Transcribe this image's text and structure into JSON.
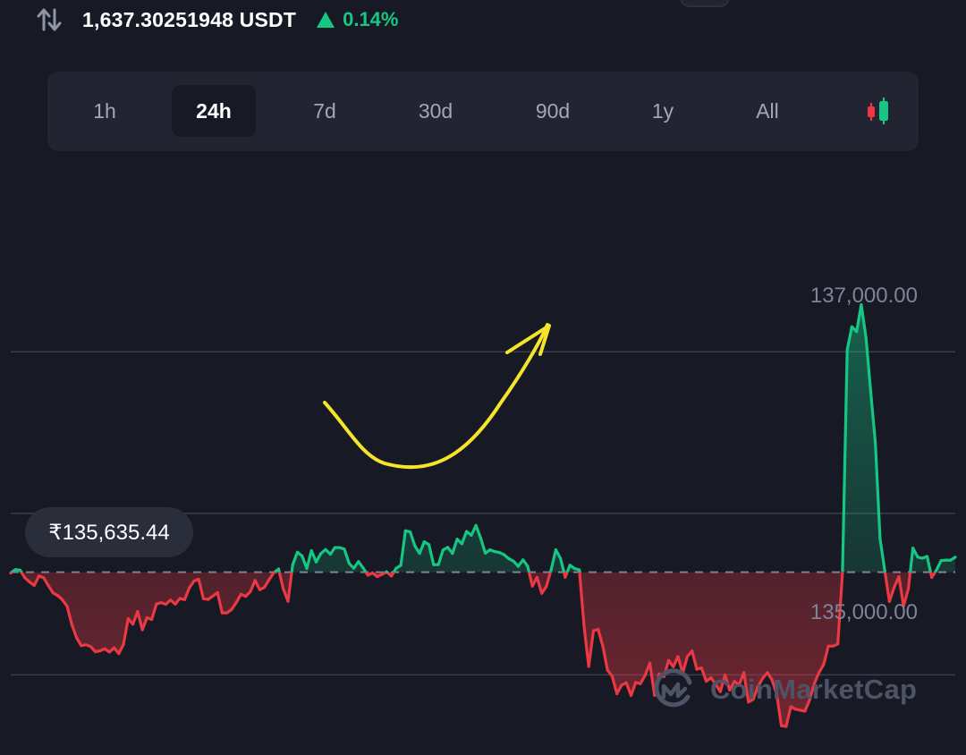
{
  "header": {
    "conversion_value": "1,637.30251948 USDT",
    "change_percent": "0.14%",
    "change_direction": "up",
    "swap_icon": "swap-vertical-arrows-icon"
  },
  "colors": {
    "background": "#171924",
    "panel": "#222531",
    "up": "#16c784",
    "down": "#ea3943",
    "grid": "#3a3e4f",
    "muted_text": "#7e8497",
    "annotation": "#f5e42a"
  },
  "tabs": [
    {
      "label": "1h",
      "active": false
    },
    {
      "label": "24h",
      "active": true
    },
    {
      "label": "7d",
      "active": false
    },
    {
      "label": "30d",
      "active": false
    },
    {
      "label": "90d",
      "active": false
    },
    {
      "label": "1y",
      "active": false
    },
    {
      "label": "All",
      "active": false
    }
  ],
  "chart_type_icon": "candlestick-icon",
  "price_badge": "₹135,635.44",
  "watermark": {
    "text": "CoinMarketCap",
    "icon": "coinmarketcap-logo-icon"
  },
  "chart_data": {
    "type": "line",
    "baseline": 135635.44,
    "ylim": [
      134620,
      137500
    ],
    "yticks": [
      135000,
      137000
    ],
    "ytick_labels": [
      "135,000.00",
      "137,000.00"
    ],
    "gridlines": [
      135000,
      136000,
      137000
    ],
    "grid": true,
    "points_count": 200,
    "values": [
      135630,
      135652,
      135648,
      135601,
      135575,
      135554,
      135612,
      135601,
      135553,
      135507,
      135491,
      135464,
      135425,
      135312,
      135230,
      135181,
      135186,
      135175,
      135143,
      135149,
      135161,
      135141,
      135167,
      135132,
      135190,
      135348,
      135314,
      135392,
      135279,
      135354,
      135343,
      135438,
      135447,
      135437,
      135463,
      135438,
      135473,
      135466,
      135538,
      135581,
      135592,
      135471,
      135467,
      135488,
      135509,
      135383,
      135384,
      135404,
      135448,
      135499,
      135486,
      135515,
      135584,
      135527,
      135542,
      135591,
      135633,
      135655,
      135533,
      135455,
      135681,
      135759,
      135736,
      135659,
      135769,
      135699,
      135751,
      135776,
      135747,
      135788,
      135788,
      135778,
      135690,
      135660,
      135701,
      135662,
      135617,
      135631,
      135608,
      135622,
      135638,
      135612,
      135659,
      135678,
      135892,
      135885,
      135799,
      135752,
      135824,
      135806,
      135682,
      135683,
      135773,
      135789,
      135752,
      135840,
      135812,
      135888,
      135864,
      135925,
      135847,
      135753,
      135774,
      135763,
      135757,
      135744,
      135719,
      135704,
      135672,
      135712,
      135673,
      135549,
      135603,
      135505,
      135548,
      135651,
      135774,
      135720,
      135604,
      135679,
      135658,
      135650,
      135302,
      135052,
      135273,
      135282,
      135177,
      135029,
      134990,
      134883,
      134937,
      134951,
      134872,
      134953,
      134945,
      134997,
      135073,
      134873,
      135005,
      134989,
      135089,
      135050,
      135113,
      135011,
      135114,
      135147,
      135035,
      135043,
      134960,
      134982,
      134941,
      134896,
      134999,
      134905,
      134959,
      134937,
      135014,
      134831,
      134849,
      134927,
      134978,
      135013,
      134969,
      134880,
      134685,
      134681,
      134802,
      134787,
      134781,
      134775,
      134844,
      134945,
      135013,
      135064,
      135178,
      135178,
      135191,
      135631,
      137013,
      137155,
      137125,
      137292,
      137088,
      136758,
      136433,
      135844,
      135644,
      135454,
      135542,
      135608,
      135426,
      135531,
      135785,
      135729,
      135722,
      135733,
      135603,
      135649,
      135707,
      135710,
      135710,
      135728
    ]
  }
}
